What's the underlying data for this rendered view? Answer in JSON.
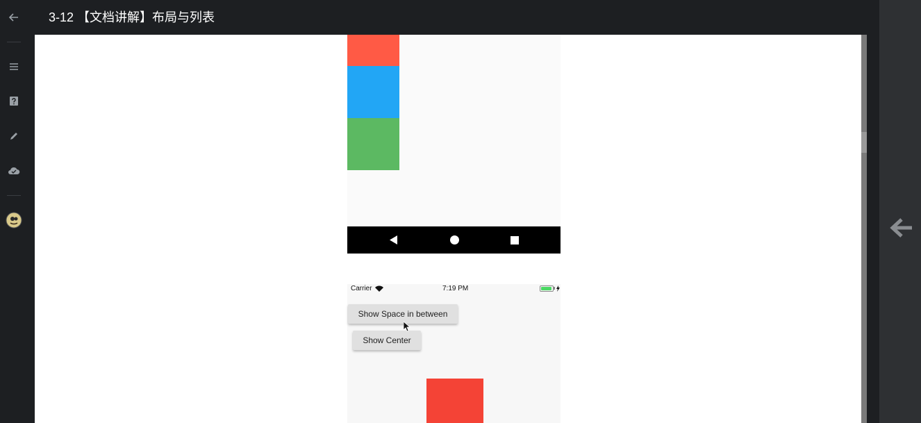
{
  "header": {
    "title": "3-12 【文档讲解】布局与列表"
  },
  "rail": {
    "items": [
      {
        "name": "back-icon"
      },
      {
        "name": "menu-icon"
      },
      {
        "name": "help-icon"
      },
      {
        "name": "edit-icon"
      },
      {
        "name": "cloud-icon"
      },
      {
        "name": "avatar"
      }
    ]
  },
  "phone1": {
    "boxes": [
      {
        "color": "#ff5a45"
      },
      {
        "color": "#22a6f5"
      },
      {
        "color": "#5cb962"
      }
    ]
  },
  "phone2": {
    "status": {
      "carrier": "Carrier",
      "time": "7:19 PM"
    },
    "buttons": {
      "space_between": "Show Space in between",
      "center": "Show Center"
    },
    "box_color": "#f44336"
  },
  "colors": {
    "accent": "#1d1f22",
    "panel": "#2e3033"
  }
}
